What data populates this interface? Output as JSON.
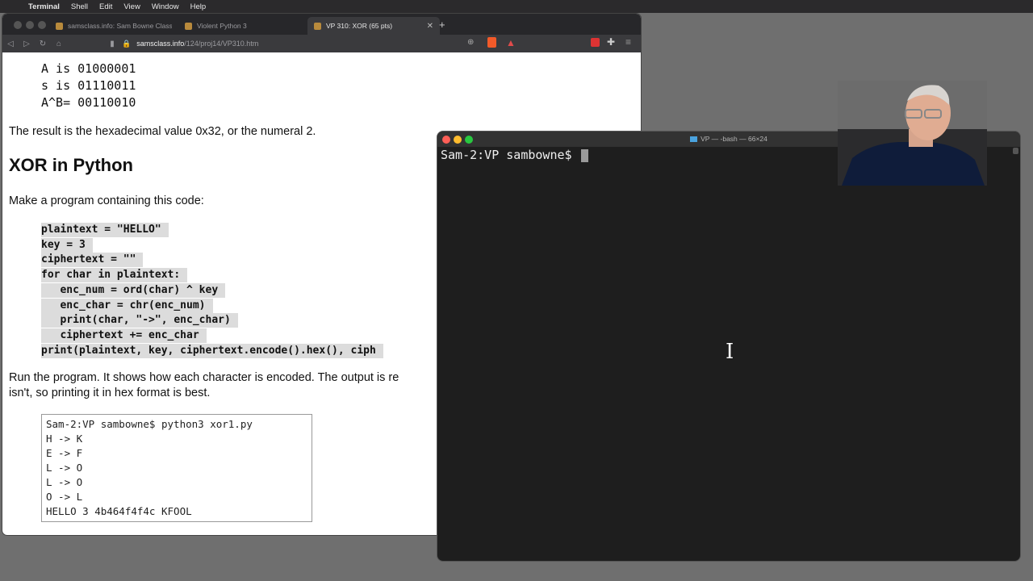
{
  "menubar": {
    "app": "Terminal",
    "items": [
      "Shell",
      "Edit",
      "View",
      "Window",
      "Help"
    ]
  },
  "browser": {
    "tabs": [
      {
        "title": "samsclass.info: Sam Bowne Class I"
      },
      {
        "title": "Violent Python 3"
      },
      {
        "title": "VP 310: XOR (65 pts)"
      }
    ],
    "url": {
      "host": "samsclass.info",
      "path": "/124/proj14/VP310.htm"
    },
    "page": {
      "xor_lines": [
        "A is 01000001",
        "s is 01110011",
        "A^B= 00110010"
      ],
      "result_text": "The result is the hexadecimal value 0x32, or the numeral 2.",
      "heading": "XOR in Python",
      "instruction": "Make a program containing this code:",
      "code": [
        "plaintext = \"HELLO\"",
        "key = 3",
        "ciphertext = \"\"",
        "for char in plaintext:",
        "   enc_num = ord(char) ^ key",
        "   enc_char = chr(enc_num)",
        "   print(char, \"->\", enc_char)",
        "   ciphertext += enc_char",
        "print(plaintext, key, ciphertext.encode().hex(), ciph"
      ],
      "run_text_1": "Run the program. It shows how each character is encoded. The output is re",
      "run_text_2": "isn't, so printing it in hex format is best.",
      "output": [
        "Sam-2:VP sambowne$ python3 xor1.py",
        "H -> K",
        "E -> F",
        "L -> O",
        "L -> O",
        "O -> L",
        "HELLO 3 4b464f4f4c KFOOL"
      ]
    }
  },
  "terminal": {
    "title": "VP — -bash — 66×24",
    "prompt": "Sam-2:VP sambowne$"
  }
}
